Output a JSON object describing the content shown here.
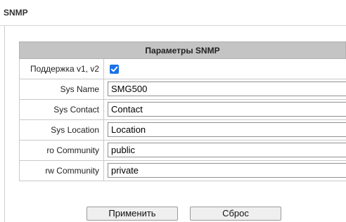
{
  "page": {
    "title": "SNMP"
  },
  "panel": {
    "header": "Параметры SNMP",
    "rows": [
      {
        "label": "Поддержка v1, v2",
        "checked": true
      },
      {
        "label": "Sys Name",
        "value": "SMG500"
      },
      {
        "label": "Sys Contact",
        "value": "Contact"
      },
      {
        "label": "Sys Location",
        "value": "Location"
      },
      {
        "label": "ro Community",
        "value": "public"
      },
      {
        "label": "rw Community",
        "value": "private"
      }
    ]
  },
  "buttons": {
    "apply_label": "Применить",
    "reset_label": "Сброс"
  },
  "colors": {
    "header_bg": "#c4c4c4",
    "checkbox_accent": "#1a73e8"
  }
}
